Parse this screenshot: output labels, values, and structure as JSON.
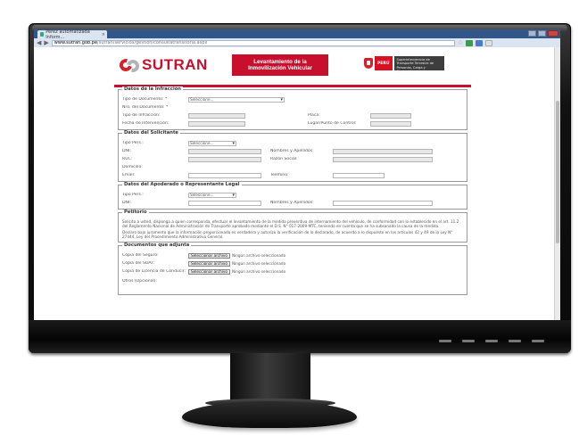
{
  "browser": {
    "tab_title": "Pérez automatizada Inform...",
    "tab_close": "×",
    "address_host": "www.sutran.gob.pe",
    "address_path": "/sutran/servicios/gestion/consultatransitoria.aspx",
    "back_glyph": "◀",
    "forward_glyph": "▶",
    "star_glyph": "☆",
    "accent_color": "#30568a"
  },
  "header": {
    "logo_text": "SUTRAN",
    "logo_tagline": "Superintendencia de Transporte Terrestre",
    "banner": "Levantamiento de la Inmovilización Vehicular",
    "gov_country": "PERÚ",
    "gov_ministry": "Superintendencia de Transporte Terrestre de Personas, Carga y Mercancías",
    "brand_color": "#c8102e"
  },
  "sections": {
    "infraccion": {
      "title": "Datos de la Infracción",
      "tipo_documento_label": "Tipo de Documento: *",
      "tipo_documento_value": "Seleccione...",
      "nro_documento_label": "Nro. del Documento: *",
      "tipo_infraccion_label": "Tipo de Infracción:",
      "placa_label": "Placa:",
      "fecha_label": "Fecha de Intervención:",
      "lugar_label": "Lugar/Punto de Control:"
    },
    "solicitante": {
      "title": "Datos del Solicitante",
      "tipo_persona_label": "Tipo Pers.:",
      "tipo_persona_value": "Seleccione...",
      "dni_label": "DNI:",
      "nombres_label": "Nombres y Apellidos:",
      "ruc_label": "RUC:",
      "razon_label": "Razón Social:",
      "domicilio_label": "Domicilio:",
      "email_label": "Email:",
      "telefono_label": "Teléfono:"
    },
    "apoderado": {
      "title": "Datos del Apoderado o Representante Legal",
      "tipo_label": "Tipo Pers.:",
      "tipo_value": "Seleccione...",
      "dni_label": "DNI:",
      "nombres_label": "Nombres y Apellidos:"
    },
    "petitorio": {
      "title": "Petitorio",
      "text1": "Solicito a usted, disponga a quien corresponda, efectuar el levantamiento de la medida preventiva de internamiento del vehículo, de conformidad con lo establecido en el art. 11.2 del Reglamento Nacional de Administración de Transporte aprobado mediante el D.S. N° 017-2009-MTC, teniendo en cuenta que se ha subsanado la causa de la medida.",
      "text2": "Declaro bajo juramento que la información proporcionada es verdadera y autorizo la verificación de lo declarado, de acuerdo a lo dispuesto en los artículos 42 y 49 de la Ley N° 27444, Ley del Procedimiento Administrativo General."
    },
    "documentos": {
      "title": "Documentos que adjunta",
      "rows": [
        {
          "label": "Copia del Seguro:",
          "button": "Seleccionar archivo",
          "status": "Ningún archivo seleccionado"
        },
        {
          "label": "Copia del SOAT:",
          "button": "Seleccionar archivo",
          "status": "Ningún archivo seleccionado"
        },
        {
          "label": "Copia de Licencia de Conducir:",
          "button": "Seleccionar archivo",
          "status": "Ningún archivo seleccionado"
        }
      ],
      "otros_label": "Otros (Opcional):"
    }
  }
}
